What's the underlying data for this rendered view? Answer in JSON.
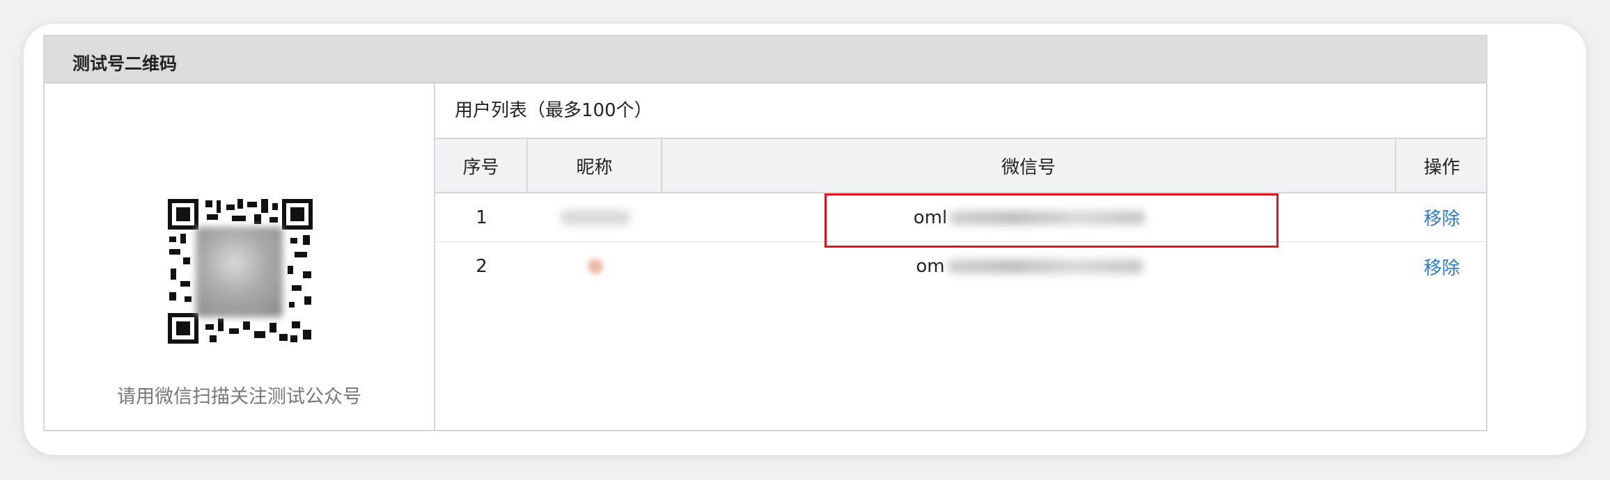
{
  "panel": {
    "title": "测试号二维码",
    "qr_caption": "请用微信扫描关注测试公众号"
  },
  "user_list": {
    "title": "用户列表（最多100个）",
    "columns": [
      "序号",
      "昵称",
      "微信号",
      "操作"
    ],
    "rows": [
      {
        "index": "1",
        "wechat_id_visible": "oml",
        "action": "移除"
      },
      {
        "index": "2",
        "wechat_id_visible": "om",
        "action": "移除"
      }
    ]
  },
  "colors": {
    "header_bg": "#dcdcdc",
    "table_header_bg": "#f1f2f6",
    "link": "#2b7bd4",
    "highlight": "#e1141e"
  }
}
